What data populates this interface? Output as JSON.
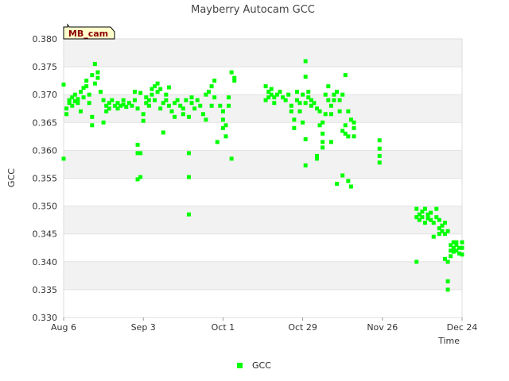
{
  "chart_data": {
    "type": "scatter",
    "title": "Mayberry Autocam GCC",
    "xlabel": "Time",
    "ylabel": "GCC",
    "badge": "MB_cam",
    "ylim": [
      0.33,
      0.38
    ],
    "yticks": [
      "0.330",
      "0.335",
      "0.340",
      "0.345",
      "0.350",
      "0.355",
      "0.360",
      "0.365",
      "0.370",
      "0.375",
      "0.380"
    ],
    "xlim": [
      "2023-08-06",
      "2023-12-24"
    ],
    "xticks": [
      {
        "label": "Aug 6",
        "date": "2023-08-06"
      },
      {
        "label": "Sep 3",
        "date": "2023-09-03"
      },
      {
        "label": "Oct 1",
        "date": "2023-10-01"
      },
      {
        "label": "Oct 29",
        "date": "2023-10-29"
      },
      {
        "label": "Nov 26",
        "date": "2023-11-26"
      },
      {
        "label": "Dec 24",
        "date": "2023-12-24"
      }
    ],
    "grid": true,
    "legend_position": "bottom",
    "colors": {
      "series": "#00ff00",
      "band": "#f2f2f2",
      "badge_fill": "#ffffcc"
    },
    "series": [
      {
        "name": "GCC",
        "points": [
          [
            "2023-08-06",
            0.3718
          ],
          [
            "2023-08-06",
            0.3585
          ],
          [
            "2023-08-07",
            0.3675
          ],
          [
            "2023-08-07",
            0.3665
          ],
          [
            "2023-08-08",
            0.3685
          ],
          [
            "2023-08-08",
            0.369
          ],
          [
            "2023-08-09",
            0.368
          ],
          [
            "2023-08-09",
            0.3695
          ],
          [
            "2023-08-10",
            0.37
          ],
          [
            "2023-08-10",
            0.3688
          ],
          [
            "2023-08-11",
            0.3685
          ],
          [
            "2023-08-11",
            0.3692
          ],
          [
            "2023-08-12",
            0.3705
          ],
          [
            "2023-08-12",
            0.367
          ],
          [
            "2023-08-13",
            0.3712
          ],
          [
            "2023-08-13",
            0.3695
          ],
          [
            "2023-08-14",
            0.3725
          ],
          [
            "2023-08-14",
            0.3715
          ],
          [
            "2023-08-15",
            0.37
          ],
          [
            "2023-08-15",
            0.3685
          ],
          [
            "2023-08-16",
            0.3735
          ],
          [
            "2023-08-16",
            0.366
          ],
          [
            "2023-08-16",
            0.3645
          ],
          [
            "2023-08-17",
            0.3755
          ],
          [
            "2023-08-17",
            0.372
          ],
          [
            "2023-08-18",
            0.374
          ],
          [
            "2023-08-18",
            0.373
          ],
          [
            "2023-08-19",
            0.3705
          ],
          [
            "2023-08-20",
            0.369
          ],
          [
            "2023-08-20",
            0.365
          ],
          [
            "2023-08-21",
            0.368
          ],
          [
            "2023-08-21",
            0.367
          ],
          [
            "2023-08-22",
            0.3675
          ],
          [
            "2023-08-22",
            0.3685
          ],
          [
            "2023-08-23",
            0.369
          ],
          [
            "2023-08-24",
            0.368
          ],
          [
            "2023-08-25",
            0.3685
          ],
          [
            "2023-08-25",
            0.3675
          ],
          [
            "2023-08-26",
            0.368
          ],
          [
            "2023-08-27",
            0.369
          ],
          [
            "2023-08-27",
            0.3682
          ],
          [
            "2023-08-28",
            0.3678
          ],
          [
            "2023-08-29",
            0.3685
          ],
          [
            "2023-08-30",
            0.368
          ],
          [
            "2023-08-31",
            0.3705
          ],
          [
            "2023-08-31",
            0.369
          ],
          [
            "2023-09-01",
            0.3675
          ],
          [
            "2023-09-01",
            0.361
          ],
          [
            "2023-09-01",
            0.3595
          ],
          [
            "2023-09-01",
            0.3548
          ],
          [
            "2023-09-02",
            0.3703
          ],
          [
            "2023-09-02",
            0.3595
          ],
          [
            "2023-09-02",
            0.3552
          ],
          [
            "2023-09-03",
            0.3665
          ],
          [
            "2023-09-03",
            0.3653
          ],
          [
            "2023-09-04",
            0.3685
          ],
          [
            "2023-09-04",
            0.3695
          ],
          [
            "2023-09-05",
            0.369
          ],
          [
            "2023-09-05",
            0.368
          ],
          [
            "2023-09-06",
            0.371
          ],
          [
            "2023-09-06",
            0.37
          ],
          [
            "2023-09-07",
            0.369
          ],
          [
            "2023-09-07",
            0.3715
          ],
          [
            "2023-09-08",
            0.372
          ],
          [
            "2023-09-08",
            0.3705
          ],
          [
            "2023-09-09",
            0.371
          ],
          [
            "2023-09-09",
            0.3675
          ],
          [
            "2023-09-10",
            0.3685
          ],
          [
            "2023-09-10",
            0.3632
          ],
          [
            "2023-09-11",
            0.37
          ],
          [
            "2023-09-11",
            0.369
          ],
          [
            "2023-09-12",
            0.3713
          ],
          [
            "2023-09-12",
            0.368
          ],
          [
            "2023-09-13",
            0.367
          ],
          [
            "2023-09-14",
            0.366
          ],
          [
            "2023-09-14",
            0.3685
          ],
          [
            "2023-09-15",
            0.369
          ],
          [
            "2023-09-16",
            0.368
          ],
          [
            "2023-09-17",
            0.3675
          ],
          [
            "2023-09-17",
            0.3665
          ],
          [
            "2023-09-18",
            0.369
          ],
          [
            "2023-09-19",
            0.366
          ],
          [
            "2023-09-19",
            0.3595
          ],
          [
            "2023-09-19",
            0.3552
          ],
          [
            "2023-09-19",
            0.3485
          ],
          [
            "2023-09-20",
            0.3695
          ],
          [
            "2023-09-20",
            0.3685
          ],
          [
            "2023-09-21",
            0.3675
          ],
          [
            "2023-09-22",
            0.369
          ],
          [
            "2023-09-23",
            0.368
          ],
          [
            "2023-09-24",
            0.3665
          ],
          [
            "2023-09-25",
            0.37
          ],
          [
            "2023-09-25",
            0.3655
          ],
          [
            "2023-09-26",
            0.3705
          ],
          [
            "2023-09-27",
            0.3715
          ],
          [
            "2023-09-27",
            0.368
          ],
          [
            "2023-09-28",
            0.3725
          ],
          [
            "2023-09-28",
            0.3695
          ],
          [
            "2023-09-29",
            0.3615
          ],
          [
            "2023-09-30",
            0.368
          ],
          [
            "2023-10-01",
            0.367
          ],
          [
            "2023-10-01",
            0.3655
          ],
          [
            "2023-10-01",
            0.364
          ],
          [
            "2023-10-02",
            0.3625
          ],
          [
            "2023-10-02",
            0.3645
          ],
          [
            "2023-10-03",
            0.3695
          ],
          [
            "2023-10-03",
            0.368
          ],
          [
            "2023-10-04",
            0.374
          ],
          [
            "2023-10-04",
            0.3585
          ],
          [
            "2023-10-05",
            0.373
          ],
          [
            "2023-10-05",
            0.3725
          ],
          [
            "2023-10-16",
            0.3715
          ],
          [
            "2023-10-16",
            0.369
          ],
          [
            "2023-10-17",
            0.3705
          ],
          [
            "2023-10-17",
            0.3695
          ],
          [
            "2023-10-18",
            0.371
          ],
          [
            "2023-10-18",
            0.37
          ],
          [
            "2023-10-19",
            0.3695
          ],
          [
            "2023-10-19",
            0.3685
          ],
          [
            "2023-10-20",
            0.37
          ],
          [
            "2023-10-21",
            0.3705
          ],
          [
            "2023-10-22",
            0.3695
          ],
          [
            "2023-10-23",
            0.369
          ],
          [
            "2023-10-24",
            0.37
          ],
          [
            "2023-10-25",
            0.368
          ],
          [
            "2023-10-25",
            0.367
          ],
          [
            "2023-10-26",
            0.364
          ],
          [
            "2023-10-26",
            0.3655
          ],
          [
            "2023-10-27",
            0.369
          ],
          [
            "2023-10-27",
            0.3705
          ],
          [
            "2023-10-28",
            0.3685
          ],
          [
            "2023-10-28",
            0.367
          ],
          [
            "2023-10-29",
            0.37
          ],
          [
            "2023-10-29",
            0.365
          ],
          [
            "2023-10-30",
            0.3685
          ],
          [
            "2023-10-30",
            0.376
          ],
          [
            "2023-10-30",
            0.3732
          ],
          [
            "2023-10-30",
            0.362
          ],
          [
            "2023-10-30",
            0.3573
          ],
          [
            "2023-10-31",
            0.3695
          ],
          [
            "2023-10-31",
            0.3705
          ],
          [
            "2023-11-01",
            0.368
          ],
          [
            "2023-11-01",
            0.369
          ],
          [
            "2023-11-02",
            0.3685
          ],
          [
            "2023-11-03",
            0.3675
          ],
          [
            "2023-11-03",
            0.359
          ],
          [
            "2023-11-03",
            0.3585
          ],
          [
            "2023-11-04",
            0.367
          ],
          [
            "2023-11-04",
            0.3645
          ],
          [
            "2023-11-05",
            0.365
          ],
          [
            "2023-11-05",
            0.363
          ],
          [
            "2023-11-05",
            0.3615
          ],
          [
            "2023-11-05",
            0.3605
          ],
          [
            "2023-11-06",
            0.3665
          ],
          [
            "2023-11-06",
            0.37
          ],
          [
            "2023-11-07",
            0.3715
          ],
          [
            "2023-11-07",
            0.369
          ],
          [
            "2023-11-08",
            0.368
          ],
          [
            "2023-11-08",
            0.3665
          ],
          [
            "2023-11-08",
            0.3615
          ],
          [
            "2023-11-09",
            0.37
          ],
          [
            "2023-11-09",
            0.369
          ],
          [
            "2023-11-10",
            0.3705
          ],
          [
            "2023-11-10",
            0.354
          ],
          [
            "2023-11-11",
            0.369
          ],
          [
            "2023-11-11",
            0.367
          ],
          [
            "2023-11-12",
            0.37
          ],
          [
            "2023-11-12",
            0.3635
          ],
          [
            "2023-11-12",
            0.3555
          ],
          [
            "2023-11-13",
            0.3735
          ],
          [
            "2023-11-13",
            0.363
          ],
          [
            "2023-11-13",
            0.3645
          ],
          [
            "2023-11-14",
            0.367
          ],
          [
            "2023-11-14",
            0.3625
          ],
          [
            "2023-11-14",
            0.3545
          ],
          [
            "2023-11-15",
            0.3655
          ],
          [
            "2023-11-15",
            0.3535
          ],
          [
            "2023-11-16",
            0.364
          ],
          [
            "2023-11-16",
            0.3625
          ],
          [
            "2023-11-16",
            0.365
          ],
          [
            "2023-11-25",
            0.3618
          ],
          [
            "2023-11-25",
            0.3603
          ],
          [
            "2023-11-25",
            0.359
          ],
          [
            "2023-11-25",
            0.3578
          ],
          [
            "2023-12-08",
            0.34
          ],
          [
            "2023-12-08",
            0.3495
          ],
          [
            "2023-12-08",
            0.348
          ],
          [
            "2023-12-09",
            0.3485
          ],
          [
            "2023-12-09",
            0.3475
          ],
          [
            "2023-12-10",
            0.349
          ],
          [
            "2023-12-10",
            0.348
          ],
          [
            "2023-12-11",
            0.3495
          ],
          [
            "2023-12-11",
            0.347
          ],
          [
            "2023-12-12",
            0.3485
          ],
          [
            "2023-12-12",
            0.3478
          ],
          [
            "2023-12-13",
            0.3488
          ],
          [
            "2023-12-13",
            0.3475
          ],
          [
            "2023-12-14",
            0.347
          ],
          [
            "2023-12-14",
            0.3445
          ],
          [
            "2023-12-15",
            0.3495
          ],
          [
            "2023-12-15",
            0.348
          ],
          [
            "2023-12-16",
            0.3475
          ],
          [
            "2023-12-16",
            0.346
          ],
          [
            "2023-12-16",
            0.345
          ],
          [
            "2023-12-17",
            0.3465
          ],
          [
            "2023-12-17",
            0.3455
          ],
          [
            "2023-12-18",
            0.347
          ],
          [
            "2023-12-18",
            0.345
          ],
          [
            "2023-12-18",
            0.3405
          ],
          [
            "2023-12-19",
            0.3455
          ],
          [
            "2023-12-19",
            0.34
          ],
          [
            "2023-12-19",
            0.3365
          ],
          [
            "2023-12-19",
            0.335
          ],
          [
            "2023-12-20",
            0.343
          ],
          [
            "2023-12-20",
            0.342
          ],
          [
            "2023-12-20",
            0.341
          ],
          [
            "2023-12-21",
            0.3435
          ],
          [
            "2023-12-21",
            0.3425
          ],
          [
            "2023-12-21",
            0.3418
          ],
          [
            "2023-12-22",
            0.343
          ],
          [
            "2023-12-22",
            0.342
          ],
          [
            "2023-12-22",
            0.3435
          ],
          [
            "2023-12-23",
            0.3425
          ],
          [
            "2023-12-23",
            0.3415
          ],
          [
            "2023-12-24",
            0.3435
          ],
          [
            "2023-12-24",
            0.3425
          ],
          [
            "2023-12-24",
            0.3413
          ]
        ]
      }
    ]
  }
}
